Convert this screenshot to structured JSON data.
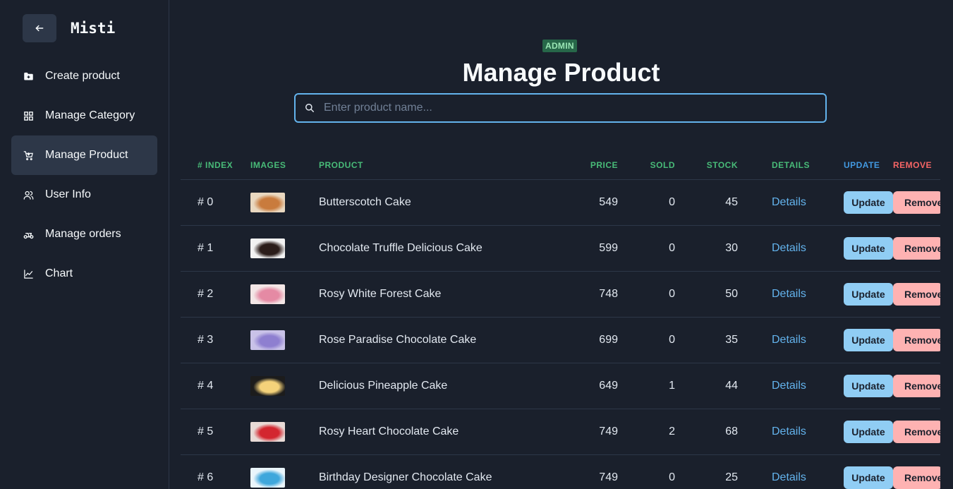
{
  "app": {
    "name": "Misti"
  },
  "sidebar": {
    "items": [
      {
        "label": "Create product",
        "icon": "folder-plus-icon",
        "active": false
      },
      {
        "label": "Manage Category",
        "icon": "grid-icon",
        "active": false
      },
      {
        "label": "Manage Product",
        "icon": "cart-icon",
        "active": true
      },
      {
        "label": "User Info",
        "icon": "users-icon",
        "active": false
      },
      {
        "label": "Manage orders",
        "icon": "scooter-icon",
        "active": false
      },
      {
        "label": "Chart",
        "icon": "line-chart-icon",
        "active": false
      }
    ]
  },
  "header": {
    "badge": "ADMIN",
    "title": "Manage Product"
  },
  "search": {
    "placeholder": "Enter product name...",
    "value": ""
  },
  "table": {
    "columns": [
      "# INDEX",
      "IMAGES",
      "PRODUCT",
      "PRICE",
      "SOLD",
      "STOCK",
      "DETAILS",
      "UPDATE",
      "REMOVE"
    ],
    "rows": [
      {
        "index": "# 0",
        "product": "Butterscotch Cake",
        "price": "549",
        "sold": "0",
        "stock": "45",
        "details": "Details",
        "update": "Update",
        "remove": "Remove",
        "thumb_colors": [
          "#e9d8c0",
          "#c97b3d"
        ]
      },
      {
        "index": "# 1",
        "product": "Chocolate Truffle Delicious Cake",
        "price": "599",
        "sold": "0",
        "stock": "30",
        "details": "Details",
        "update": "Update",
        "remove": "Remove",
        "thumb_colors": [
          "#f2f2f2",
          "#2b1d1a"
        ]
      },
      {
        "index": "# 2",
        "product": "Rosy White Forest Cake",
        "price": "748",
        "sold": "0",
        "stock": "50",
        "details": "Details",
        "update": "Update",
        "remove": "Remove",
        "thumb_colors": [
          "#f3e6e6",
          "#e58aa4"
        ]
      },
      {
        "index": "# 3",
        "product": "Rose Paradise Chocolate Cake",
        "price": "699",
        "sold": "0",
        "stock": "35",
        "details": "Details",
        "update": "Update",
        "remove": "Remove",
        "thumb_colors": [
          "#c9c2e8",
          "#8e7fd0"
        ]
      },
      {
        "index": "# 4",
        "product": "Delicious Pineapple Cake",
        "price": "649",
        "sold": "1",
        "stock": "44",
        "details": "Details",
        "update": "Update",
        "remove": "Remove",
        "thumb_colors": [
          "#1c1c1c",
          "#f4d27a"
        ]
      },
      {
        "index": "# 5",
        "product": "Rosy Heart Chocolate Cake",
        "price": "749",
        "sold": "2",
        "stock": "68",
        "details": "Details",
        "update": "Update",
        "remove": "Remove",
        "thumb_colors": [
          "#e8dad6",
          "#d3262f"
        ]
      },
      {
        "index": "# 6",
        "product": "Birthday Designer Chocolate Cake",
        "price": "749",
        "sold": "0",
        "stock": "25",
        "details": "Details",
        "update": "Update",
        "remove": "Remove",
        "thumb_colors": [
          "#eaf5fb",
          "#3fa7dc"
        ]
      }
    ]
  },
  "colors": {
    "accent_green": "#48bb78",
    "accent_blue": "#4299e1",
    "accent_red": "#f56565",
    "background": "#1a202c"
  }
}
